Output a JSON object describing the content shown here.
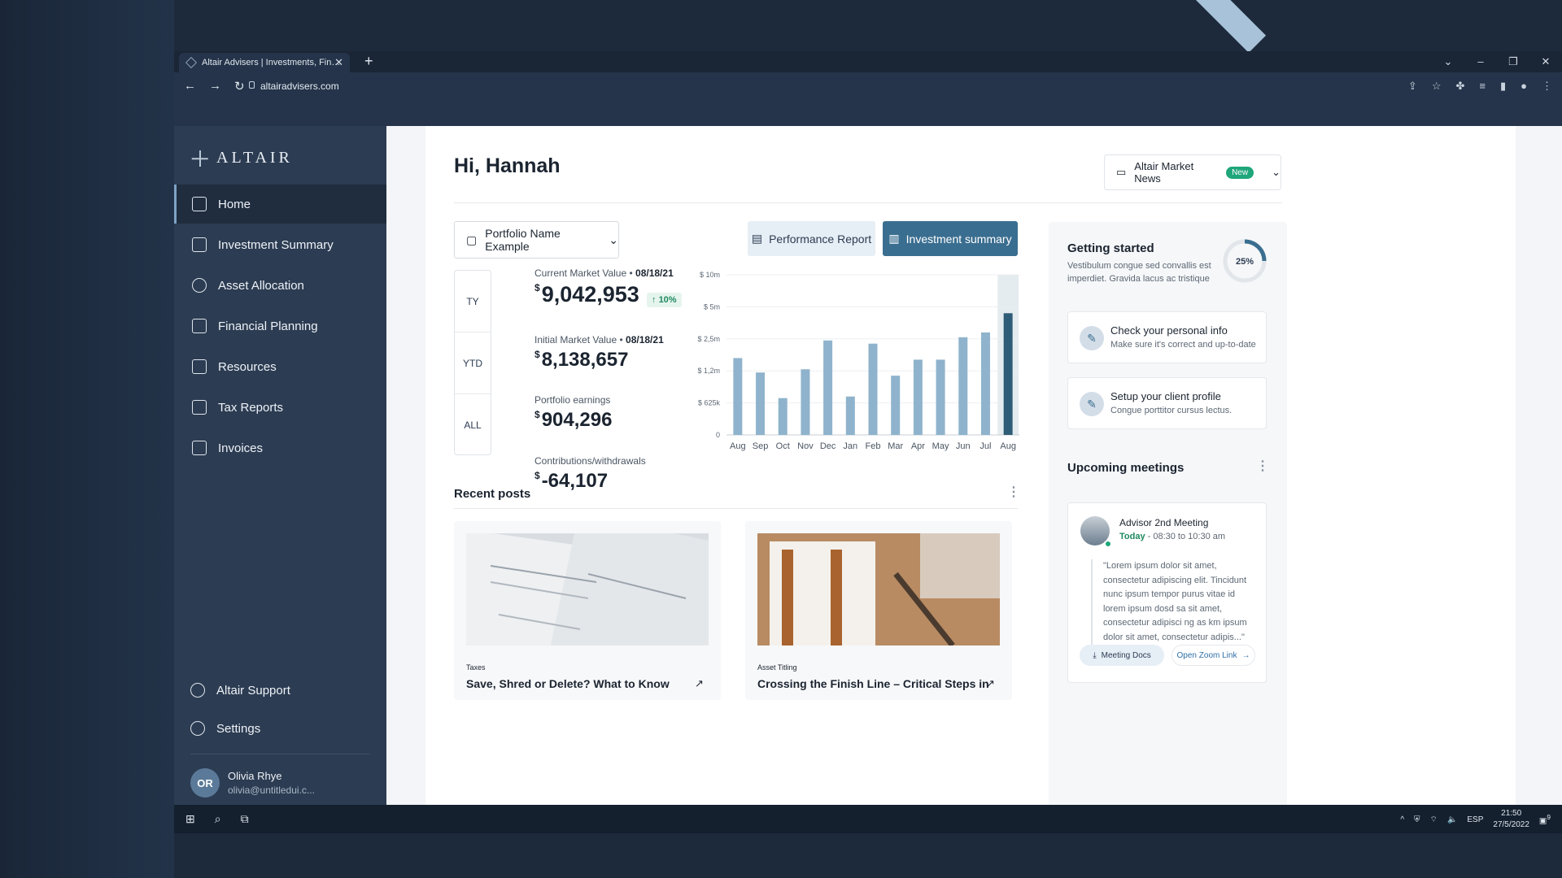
{
  "browser": {
    "tab_title": "Altair Advisers | Investments, Fin…",
    "url": "altairadvisers.com"
  },
  "sidebar": {
    "brand": "ALTAIR",
    "items": [
      {
        "label": "Home",
        "icon": "home-icon"
      },
      {
        "label": "Investment Summary",
        "icon": "bar-chart-icon"
      },
      {
        "label": "Asset Allocation",
        "icon": "pie-chart-icon"
      },
      {
        "label": "Financial Planning",
        "icon": "clipboard-dollar-icon"
      },
      {
        "label": "Resources",
        "icon": "graduation-cap-icon"
      },
      {
        "label": "Tax Reports",
        "icon": "copy-dollar-icon"
      },
      {
        "label": "Invoices",
        "icon": "document-icon"
      }
    ],
    "support_label": "Altair Support",
    "settings_label": "Settings",
    "user": {
      "initials": "OR",
      "name": "Olivia Rhye",
      "email": "olivia@untitledui.c..."
    }
  },
  "header": {
    "greeting": "Hi, Hannah",
    "news_label": "Altair Market News",
    "news_badge": "New"
  },
  "portfolio": {
    "selector": "Portfolio Name Example",
    "perf_report": "Performance Report",
    "inv_summary": "Investment summary",
    "periods": [
      "TY",
      "YTD",
      "ALL"
    ],
    "current_label": "Current Market Value",
    "current_date": "08/18/21",
    "current_value": "9,042,953",
    "current_change": "10%",
    "initial_label": "Initial Market Value",
    "initial_date": "08/18/21",
    "initial_value": "8,138,657",
    "earnings_label": "Portfolio earnings",
    "earnings_value": "904,296",
    "contrib_label": "Contributions/withdrawals",
    "contrib_value": "-64,107",
    "currency": "$"
  },
  "chart_data": {
    "type": "bar",
    "categories": [
      "Aug",
      "Sep",
      "Oct",
      "Nov",
      "Dec",
      "Jan",
      "Feb",
      "Mar",
      "Apr",
      "May",
      "Jun",
      "Jul",
      "Aug"
    ],
    "values": [
      0.48,
      0.39,
      0.23,
      0.41,
      0.59,
      0.24,
      0.57,
      0.37,
      0.47,
      0.47,
      0.61,
      0.64,
      0.76
    ],
    "value_scale": "fraction of axis height (tick spacing non-linear)",
    "y_ticks": [
      "0",
      "$ 625k",
      "$ 1,2m",
      "$ 2,5m",
      "$ 5m",
      "$ 10m"
    ],
    "highlighted_index": 12,
    "colors": {
      "bar": "#8fb3cc",
      "highlight": "#2f5d77",
      "highlight_bg": "#e4ecef"
    },
    "grid": true
  },
  "posts": {
    "section_title": "Recent posts",
    "items": [
      {
        "category": "Taxes",
        "title": "Save, Shred or Delete? What to Know"
      },
      {
        "category": "Asset Titling",
        "title": "Crossing the Finish Line – Critical Steps in"
      }
    ]
  },
  "getting_started": {
    "title": "Getting started",
    "desc": "Vestibulum congue sed convallis est imperdiet. Gravida lacus ac tristique",
    "progress": "25%",
    "progress_fraction": 0.25,
    "tasks": [
      {
        "title": "Check your personal info",
        "sub": "Make sure it's correct and up-to-date"
      },
      {
        "title": "Setup your client profile",
        "sub": "Congue porttitor cursus lectus."
      }
    ]
  },
  "meetings": {
    "title": "Upcoming meetings",
    "meeting_title": "Advisor 2nd Meeting",
    "day": "Today",
    "time": " - 08:30 to 10:30 am",
    "quote": "\"Lorem ipsum dolor sit amet, consectetur adipiscing elit. Tincidunt nunc ipsum tempor purus vitae id lorem ipsum dosd sa sit amet, consectetur adipisci ng as km ipsum dolor sit amet, consectetur adipis...\"",
    "docs_btn": "Meeting Docs",
    "zoom_btn": "Open Zoom Link"
  },
  "taskbar": {
    "lang": "ESP",
    "time": "21:50",
    "date": "27/5/2022",
    "notif_count": "9"
  }
}
